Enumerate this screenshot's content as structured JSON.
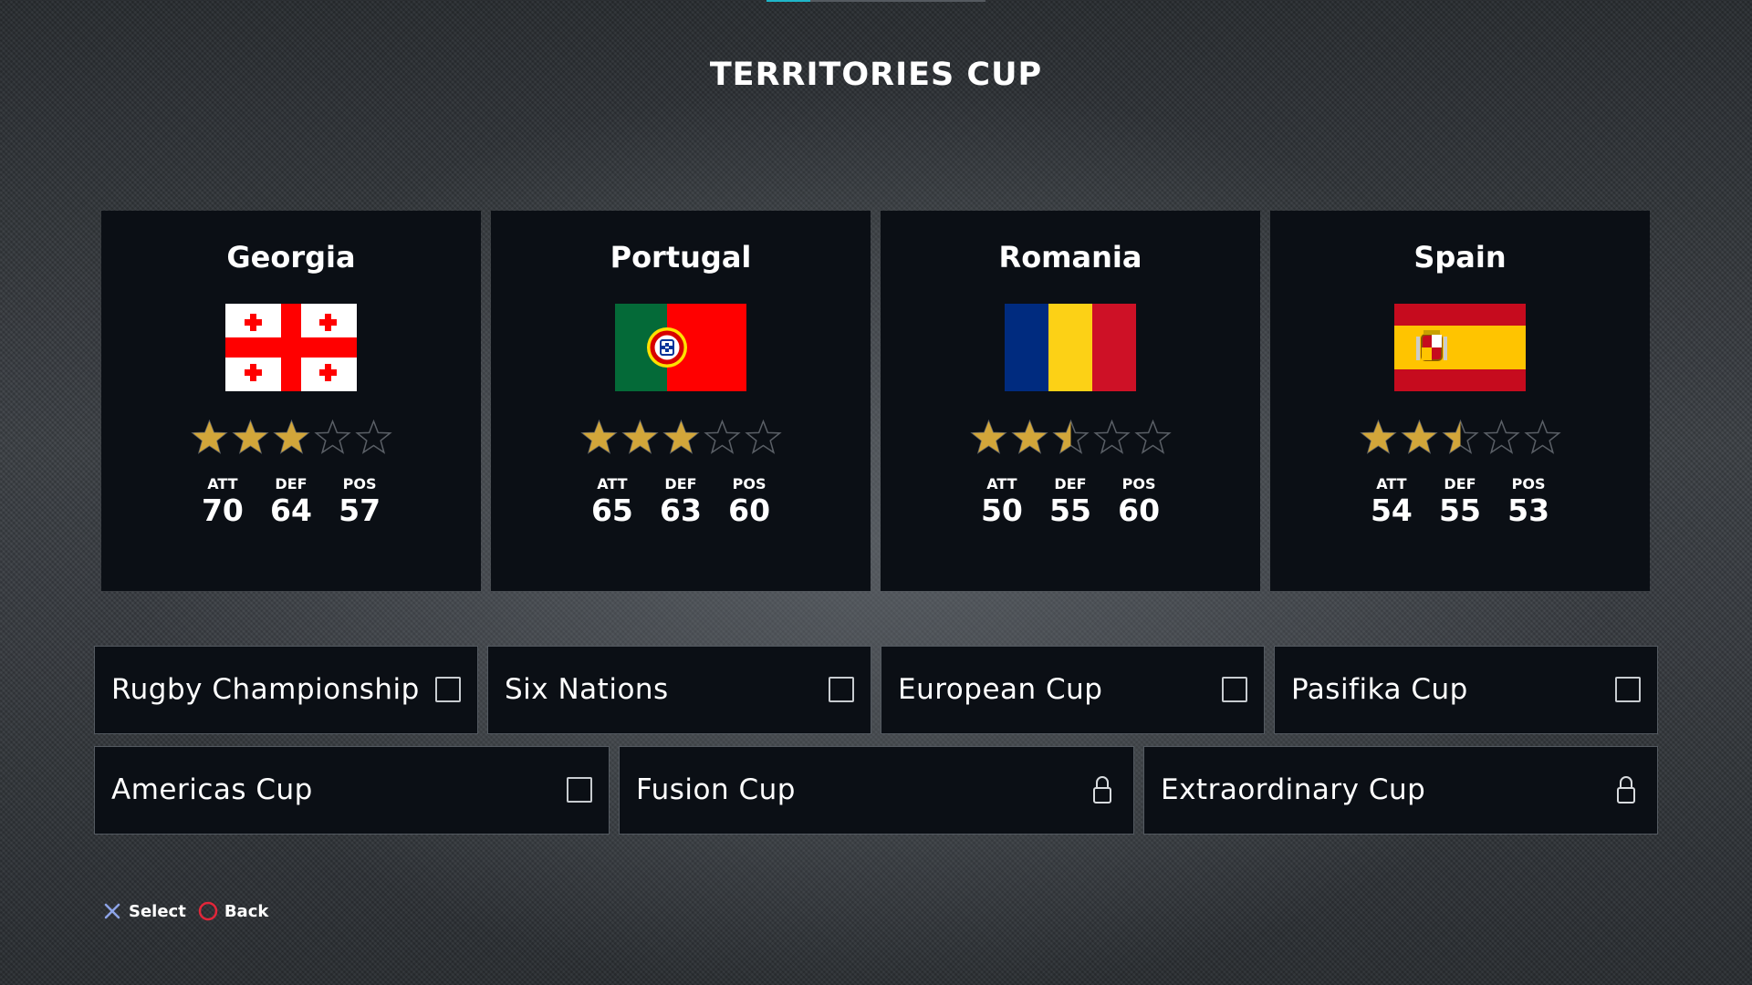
{
  "page": {
    "title": "TERRITORIES CUP"
  },
  "teams": [
    {
      "name": "Georgia",
      "flag": "georgia-flag-icon",
      "rating_stars": 3.0,
      "stat_labels": {
        "att": "ATT",
        "def": "DEF",
        "pos": "POS"
      },
      "stats": {
        "att": "70",
        "def": "64",
        "pos": "57"
      }
    },
    {
      "name": "Portugal",
      "flag": "portugal-flag-icon",
      "rating_stars": 3.0,
      "stat_labels": {
        "att": "ATT",
        "def": "DEF",
        "pos": "POS"
      },
      "stats": {
        "att": "65",
        "def": "63",
        "pos": "60"
      }
    },
    {
      "name": "Romania",
      "flag": "romania-flag-icon",
      "rating_stars": 2.5,
      "stat_labels": {
        "att": "ATT",
        "def": "DEF",
        "pos": "POS"
      },
      "stats": {
        "att": "50",
        "def": "55",
        "pos": "60"
      }
    },
    {
      "name": "Spain",
      "flag": "spain-flag-icon",
      "rating_stars": 2.5,
      "stat_labels": {
        "att": "ATT",
        "def": "DEF",
        "pos": "POS"
      },
      "stats": {
        "att": "54",
        "def": "55",
        "pos": "53"
      }
    }
  ],
  "competitions": [
    {
      "label": "Rugby Championship",
      "state": "checkbox-unchecked"
    },
    {
      "label": "Six Nations",
      "state": "checkbox-unchecked"
    },
    {
      "label": "European Cup",
      "state": "checkbox-unchecked"
    },
    {
      "label": "Pasifika Cup",
      "state": "checkbox-unchecked"
    },
    {
      "label": "Americas Cup",
      "state": "checkbox-unchecked"
    },
    {
      "label": "Fusion Cup",
      "state": "locked"
    },
    {
      "label": "Extraordinary Cup",
      "state": "locked"
    }
  ],
  "footer": {
    "select_label": "Select",
    "select_icon": "cross-button-icon",
    "back_label": "Back",
    "back_icon": "circle-button-icon"
  },
  "colors": {
    "accent": "#1fb6c9",
    "star_filled": "#d2a63a",
    "star_empty": "#5a5f66",
    "card_bg": "#0b0f15",
    "cross_button": "#8da4e8",
    "circle_button": "#e2263a"
  }
}
